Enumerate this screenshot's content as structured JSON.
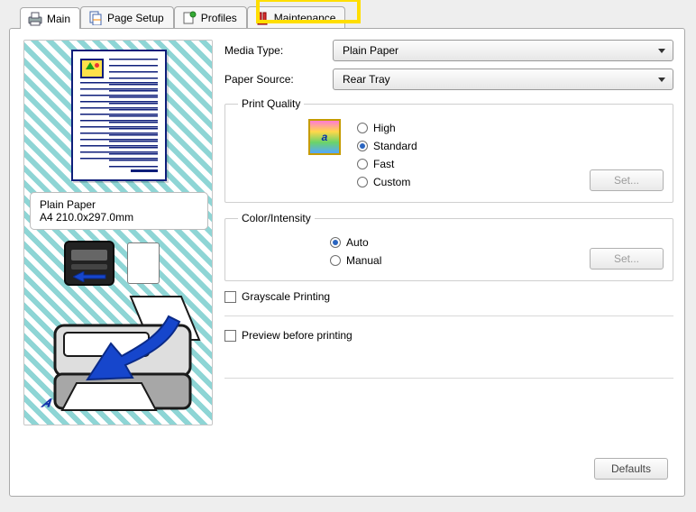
{
  "tabs": {
    "main": "Main",
    "pageSetup": "Page Setup",
    "profiles": "Profiles",
    "maintenance": "Maintenance"
  },
  "mediaType": {
    "label": "Media Type:",
    "value": "Plain Paper"
  },
  "paperSource": {
    "label": "Paper Source:",
    "value": "Rear Tray"
  },
  "printQuality": {
    "legend": "Print Quality",
    "options": {
      "high": "High",
      "standard": "Standard",
      "fast": "Fast",
      "custom": "Custom"
    },
    "selected": "standard",
    "setButton": "Set..."
  },
  "colorIntensity": {
    "legend": "Color/Intensity",
    "options": {
      "auto": "Auto",
      "manual": "Manual"
    },
    "selected": "auto",
    "setButton": "Set..."
  },
  "checks": {
    "grayscale": "Grayscale Printing",
    "preview": "Preview before printing"
  },
  "status": {
    "line1": "Plain Paper",
    "line2": "A4 210.0x297.0mm"
  },
  "defaults": "Defaults",
  "qualityGlyph": "a"
}
